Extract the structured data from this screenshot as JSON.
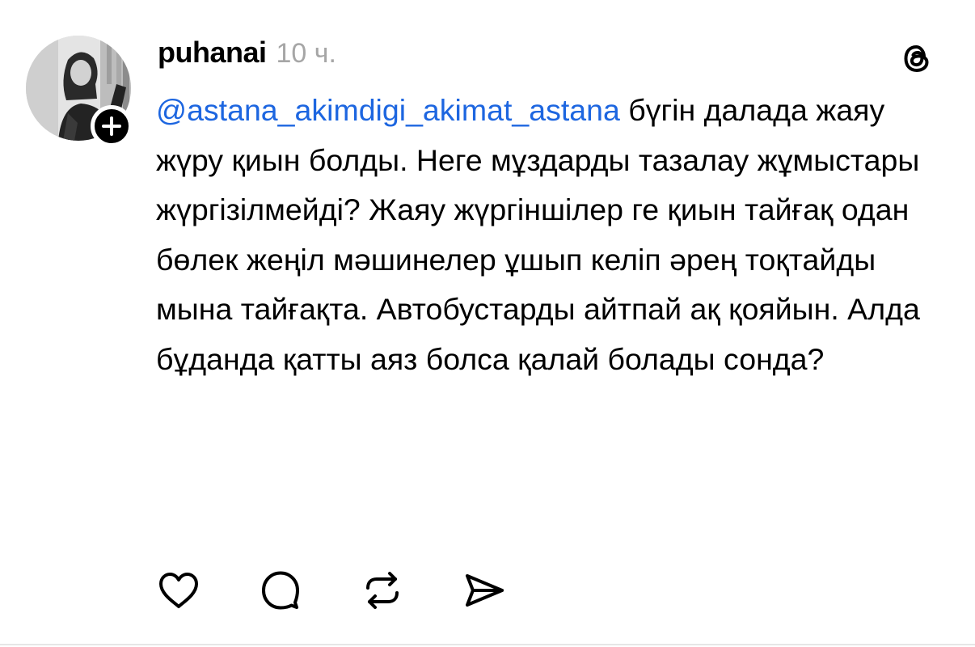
{
  "post": {
    "username": "puhanai",
    "timestamp": "10 ч.",
    "mention": "@astana_akimdigi_akimat_astana",
    "text": "бүгін далада жаяу жүру қиын болды. Неге мұздарды тазалау жұмыстары жүргізілмейді? Жаяу жүргіншілер ге қиын тайғақ одан бөлек жеңіл мәшинелер ұшып келіп әрең тоқтайды мына тайғақта. Автобустарды айтпай ақ қояйын. Алда бұданда қатты аяз болса қалай болады сонда?"
  },
  "icons": {
    "avatar": "avatar-photo",
    "follow": "plus-icon",
    "brand": "threads-logo-icon",
    "like": "heart-icon",
    "reply": "comment-bubble-icon",
    "repost": "repost-icon",
    "share": "send-icon"
  },
  "colors": {
    "mention": "#1d66e0",
    "timestamp": "#a6a6a6",
    "text": "#000000"
  }
}
